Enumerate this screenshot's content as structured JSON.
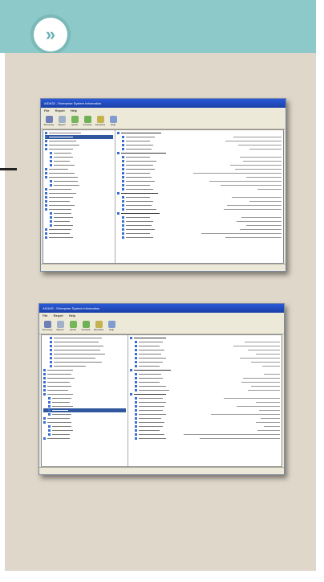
{
  "header": {
    "color": "#8cc9c8",
    "icon": "double-chevron-right-icon",
    "icon_glyph": "»"
  },
  "screenshots": [
    {
      "title": "AIDA32 - Enterprise System Information",
      "menu": [
        "File",
        "Report",
        "Help"
      ],
      "toolbar": [
        "Summary",
        "Report",
        "Quick",
        "Console",
        "Favorites",
        "Help"
      ]
    },
    {
      "title": "AIDA32 - Enterprise System Information",
      "menu": [
        "File",
        "Report",
        "Help"
      ],
      "toolbar": [
        "Summary",
        "Report",
        "Quick",
        "Console",
        "Favorites",
        "Help"
      ]
    }
  ]
}
